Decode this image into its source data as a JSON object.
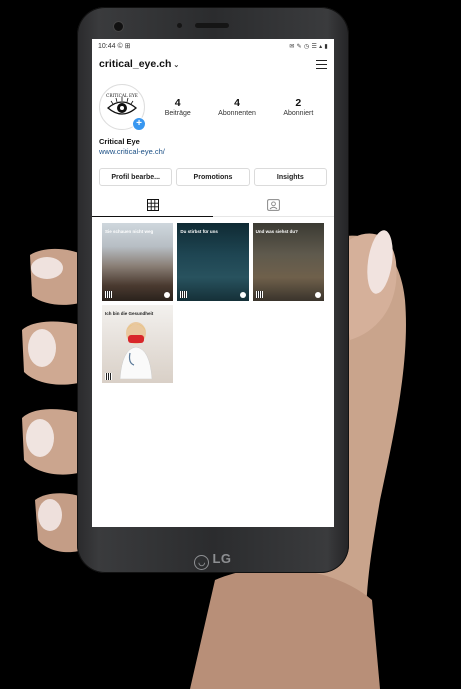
{
  "status": {
    "time": "10:44",
    "icons_left": "© ⊞",
    "icons_right": "✉ ✎ ◷ ☰ ▴ ▮"
  },
  "profile": {
    "username": "critical_eye.ch",
    "display_name": "Critical Eye",
    "website": "www.critical-eye.ch/",
    "avatar_text": "CRITICAL EYE",
    "stats": [
      {
        "value": "4",
        "label": "Beiträge"
      },
      {
        "value": "4",
        "label": "Abonnenten"
      },
      {
        "value": "2",
        "label": "Abonniert"
      }
    ]
  },
  "buttons": {
    "edit": "Profil bearbe...",
    "promotions": "Promotions",
    "insights": "Insights"
  },
  "posts": [
    {
      "text": "Sie schauen nicht weg"
    },
    {
      "text": "Du stirbst für uns"
    },
    {
      "text": "Und was siehst du?"
    },
    {
      "text": "Ich bin die Gesundheit"
    }
  ],
  "device": {
    "brand": "LG"
  },
  "colors": {
    "accent": "#3897f0",
    "link": "#1a4f85"
  }
}
